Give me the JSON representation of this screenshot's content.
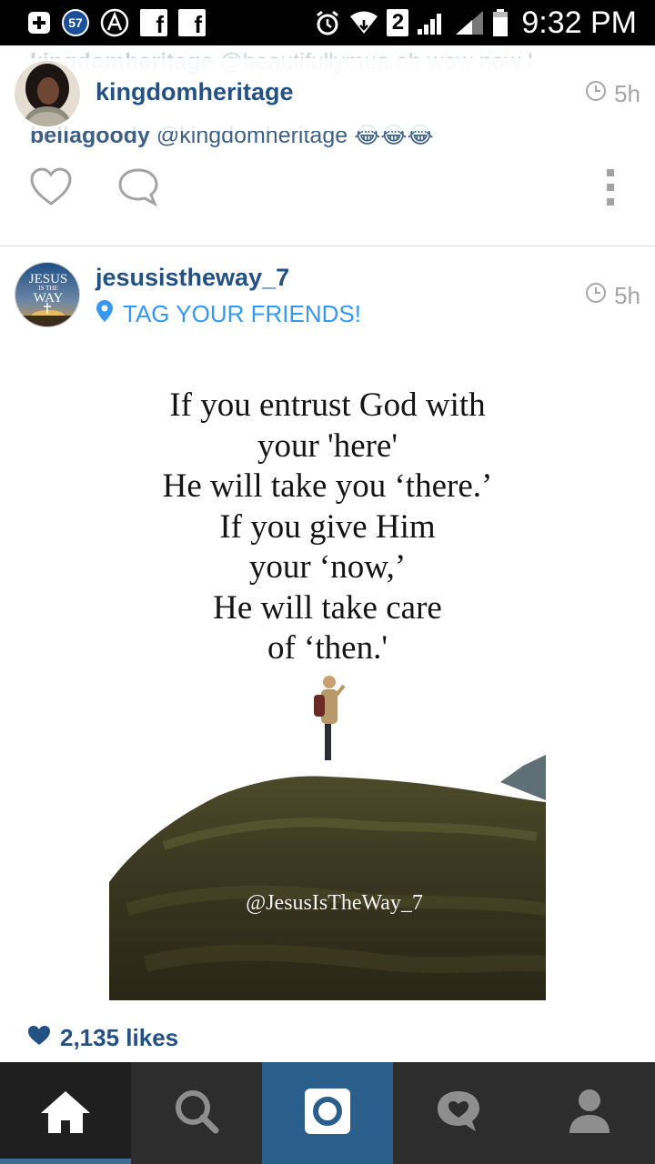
{
  "status_bar": {
    "notification_count": "57",
    "sim_badge": "2",
    "time": "9:32 PM",
    "icons": [
      "plus-box-icon",
      "notification-count-icon",
      "a-logo-icon",
      "facebook-icon",
      "facebook-icon",
      "alarm-icon",
      "wifi-icon",
      "sim-2-icon",
      "signal-icon",
      "signal-icon",
      "battery-icon"
    ]
  },
  "comments": [
    {
      "user": "kingdomheritage",
      "text": "@beautifullymua oh wow now I"
    },
    {
      "user": "bellagoody",
      "text": "@kingdomheritage 😂😂😂"
    }
  ],
  "post1": {
    "username": "kingdomheritage",
    "time": "5h"
  },
  "post2": {
    "username": "jesusistheway_7",
    "location": "TAG YOUR FRIENDS!",
    "time": "5h",
    "avatar_text": {
      "line1": "JESUS",
      "line2": "IS THE",
      "line3": "WAY"
    },
    "image": {
      "quote_lines": [
        "If you entrust God with",
        "your 'here'",
        "He will take you ‘there.’",
        "If you give Him",
        "your ‘now,’",
        "He will take care",
        "of ‘then.'"
      ],
      "watermark": "@JesusIsTheWay_7"
    },
    "likes": "2,135 likes"
  },
  "nav": {
    "tabs": [
      "home",
      "search",
      "camera",
      "activity",
      "profile"
    ],
    "active": "home"
  },
  "colors": {
    "accent_blue": "#235183",
    "location_blue": "#3897f0",
    "nav_bg": "#2d2d2d",
    "nav_active_tab": "#2b5f8b"
  }
}
